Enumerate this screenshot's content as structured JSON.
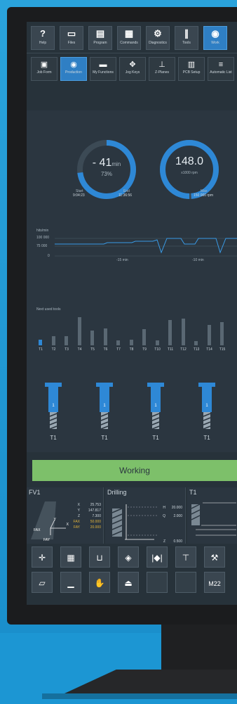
{
  "toolbar": [
    {
      "label": "Help",
      "icon": "question-icon",
      "glyph": "?"
    },
    {
      "label": "Files",
      "icon": "folder-icon",
      "glyph": "▭"
    },
    {
      "label": "Program",
      "icon": "program-icon",
      "glyph": "▤"
    },
    {
      "label": "Commands",
      "icon": "commands-icon",
      "glyph": "▦"
    },
    {
      "label": "Diagnostics",
      "icon": "wrench-icon",
      "glyph": "⚙"
    },
    {
      "label": "Tools",
      "icon": "drill-icon",
      "glyph": "∥"
    },
    {
      "label": "Work",
      "icon": "work-icon",
      "glyph": "◉",
      "active": true
    }
  ],
  "subtoolbar": [
    {
      "label": "Job Form",
      "icon": "job-form-icon",
      "glyph": "▣"
    },
    {
      "label": "Production",
      "icon": "production-icon",
      "glyph": "◉",
      "active": true
    },
    {
      "label": "My Functions",
      "icon": "functions-icon",
      "glyph": "▬"
    },
    {
      "label": "Jog Keys",
      "icon": "jog-icon",
      "glyph": "✥"
    },
    {
      "label": "Z-Planes",
      "icon": "zplanes-icon",
      "glyph": "⊥"
    },
    {
      "label": "PCB Setup",
      "icon": "pcb-icon",
      "glyph": "▥"
    },
    {
      "label": "Automatic List",
      "icon": "list-icon",
      "glyph": "≡"
    }
  ],
  "time_gauge": {
    "value": "- 41",
    "unit": "min",
    "percent": "73",
    "percent_unit": "%",
    "start_label": "Start",
    "start_time": "9:04:23",
    "end_label": "End",
    "end_time": "11:36:56",
    "progress": 0.73
  },
  "speed_gauge": {
    "value": "148.0",
    "unit": "x1000 rpm",
    "max_label": "Max",
    "max_value": "150 000 rpm",
    "progress": 0.987
  },
  "hits_chart": {
    "title": "hits/min",
    "ticks": [
      "100 000",
      "75 000",
      "0"
    ],
    "marker1": "-15 min",
    "marker2": "-10 min"
  },
  "next_tools": {
    "title": "Next used tools",
    "labels": [
      "T1",
      "T2",
      "T3",
      "T4",
      "T5",
      "T6",
      "T7",
      "T8",
      "T9",
      "T10",
      "T11",
      "T12",
      "T13",
      "T14",
      "T15"
    ],
    "values": [
      0.2,
      0.32,
      0.32,
      1.0,
      0.52,
      0.6,
      0.17,
      0.2,
      0.57,
      0.17,
      0.9,
      0.95,
      0.16,
      0.72,
      0.83
    ]
  },
  "tools": [
    {
      "label": "T1",
      "num": "1"
    },
    {
      "label": "T1",
      "num": "1"
    },
    {
      "label": "T1",
      "num": "1"
    },
    {
      "label": "T1",
      "num": "1"
    }
  ],
  "status": "Working",
  "fv1": {
    "title": "FV1",
    "rows": [
      [
        "X",
        "25.753"
      ],
      [
        "Y",
        "147.817"
      ],
      [
        "Z",
        "7.300"
      ],
      [
        "FAX",
        "50.000"
      ],
      [
        "FAY",
        "20.000"
      ]
    ],
    "axis_x": "X",
    "axis_y": "Y",
    "label_fax": "FAX",
    "label_fay": "FAY"
  },
  "drilling": {
    "title": "Drilling",
    "rows": [
      [
        "H",
        "20.000"
      ],
      [
        "Q",
        "2.000"
      ],
      [
        "Z",
        "0.500"
      ]
    ]
  },
  "t1panel": {
    "title": "T1"
  },
  "bottom_grid": [
    [
      {
        "icon": "crosshair-icon",
        "glyph": "✛"
      },
      {
        "icon": "machine-icon",
        "glyph": "▦"
      },
      {
        "icon": "gripper-icon",
        "glyph": "⊔"
      },
      {
        "icon": "center-icon",
        "glyph": "◈"
      },
      {
        "icon": "align-icon",
        "glyph": "|◆|"
      },
      {
        "icon": "tool-length-icon",
        "glyph": "⊤"
      },
      {
        "icon": "wrench-icon",
        "glyph": "⚒"
      }
    ],
    [
      {
        "icon": "conveyor-icon",
        "glyph": "▱"
      },
      {
        "icon": "table-icon",
        "glyph": "▁"
      },
      {
        "icon": "hand-icon",
        "glyph": "✋"
      },
      {
        "icon": "eject-icon",
        "glyph": "⏏"
      },
      {
        "icon": "empty",
        "glyph": ""
      },
      {
        "icon": "empty",
        "glyph": ""
      },
      {
        "icon": "m22-icon",
        "glyph": "M22"
      }
    ]
  ],
  "colors": {
    "accent": "#2f7fc4",
    "working": "#7dc06a",
    "bar": "#5a6873"
  }
}
